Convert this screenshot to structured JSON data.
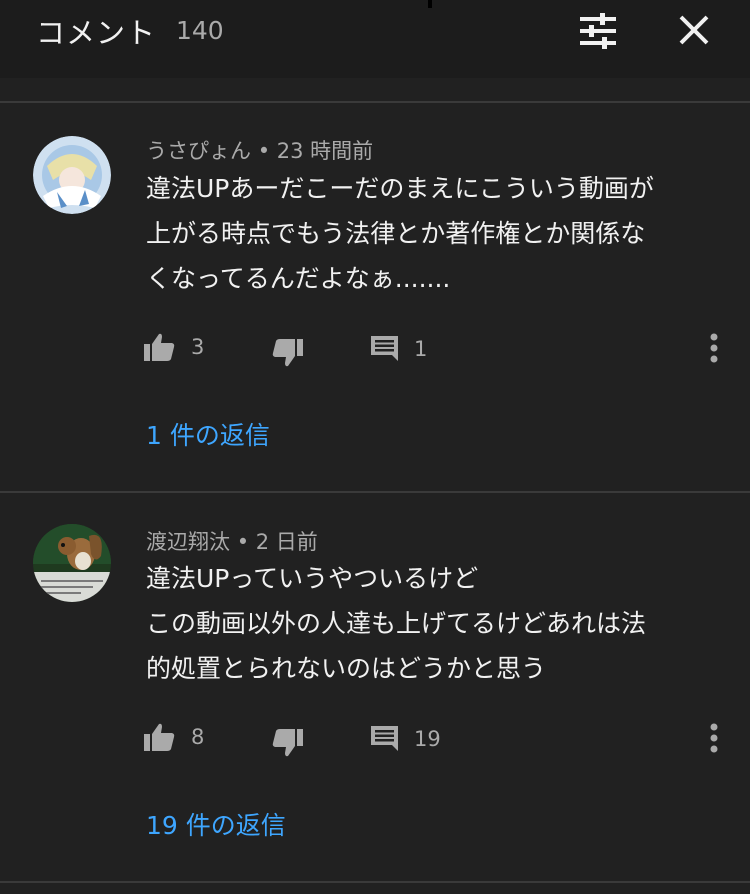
{
  "header": {
    "title": "コメント",
    "count": "140",
    "filter_icon": "sliders-icon",
    "close_icon": "close-icon"
  },
  "comments": [
    {
      "author": "うさぴょん",
      "time": "23 時間前",
      "lines": [
        "違法UPあーだこーだのまえにこういう動画が",
        "上がる時点でもう法律とか著作権とか関係な",
        "くなってるんだよなぁ......."
      ],
      "likes": "3",
      "replies": "1",
      "replies_link": "1 件の返信"
    },
    {
      "author": "渡辺翔汰",
      "time": "2 日前",
      "lines": [
        "違法UPっていうやついるけど",
        "この動画以外の人達も上げてるけどあれは法",
        "的処置とられないのはどうかと思う"
      ],
      "likes": "8",
      "replies": "19",
      "replies_link": "19 件の返信"
    }
  ],
  "separator": "•",
  "colors": {
    "background": "#212121",
    "header": "#1c1c1c",
    "text": "#f1f1f1",
    "secondary": "#aaaaaa",
    "link": "#3ea6ff"
  }
}
